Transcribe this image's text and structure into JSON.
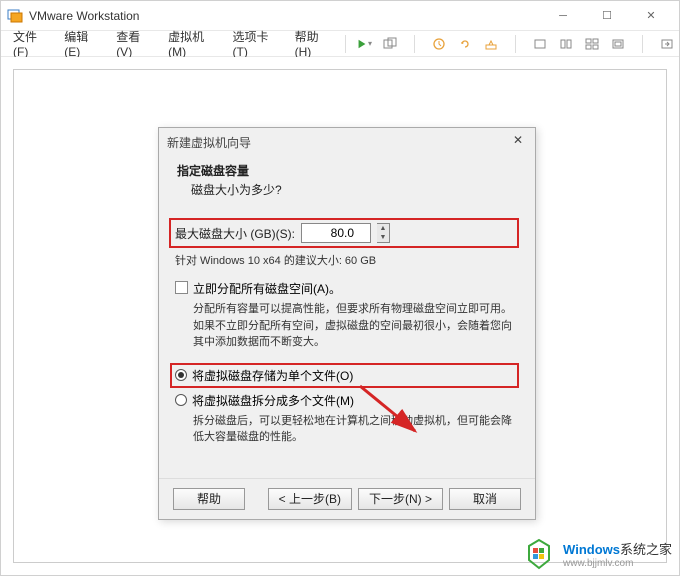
{
  "window": {
    "title": "VMware Workstation"
  },
  "menu": {
    "file": "文件(F)",
    "edit": "编辑(E)",
    "view": "查看(V)",
    "vm": "虚拟机(M)",
    "tabs": "选项卡(T)",
    "help": "帮助(H)"
  },
  "wizard": {
    "title": "新建虚拟机向导",
    "header_bold": "指定磁盘容量",
    "header_sub": "磁盘大小为多少?",
    "max_disk_label": "最大磁盘大小 (GB)(S):",
    "max_disk_value": "80.0",
    "recommendation": "针对 Windows 10 x64 的建议大小: 60 GB",
    "allocate_now": "立即分配所有磁盘空间(A)。",
    "allocate_desc": "分配所有容量可以提高性能，但要求所有物理磁盘空间立即可用。如果不立即分配所有空间，虚拟磁盘的空间最初很小，会随着您向其中添加数据而不断变大。",
    "single_file": "将虚拟磁盘存储为单个文件(O)",
    "split_files": "将虚拟磁盘拆分成多个文件(M)",
    "split_desc": "拆分磁盘后，可以更轻松地在计算机之间移动虚拟机，但可能会降低大容量磁盘的性能。",
    "btn_help": "帮助",
    "btn_back": "< 上一步(B)",
    "btn_next": "下一步(N) >",
    "btn_cancel": "取消"
  },
  "watermark": {
    "brand": "Windows",
    "suffix": "系统之家",
    "url": "www.bjjmlv.com"
  }
}
